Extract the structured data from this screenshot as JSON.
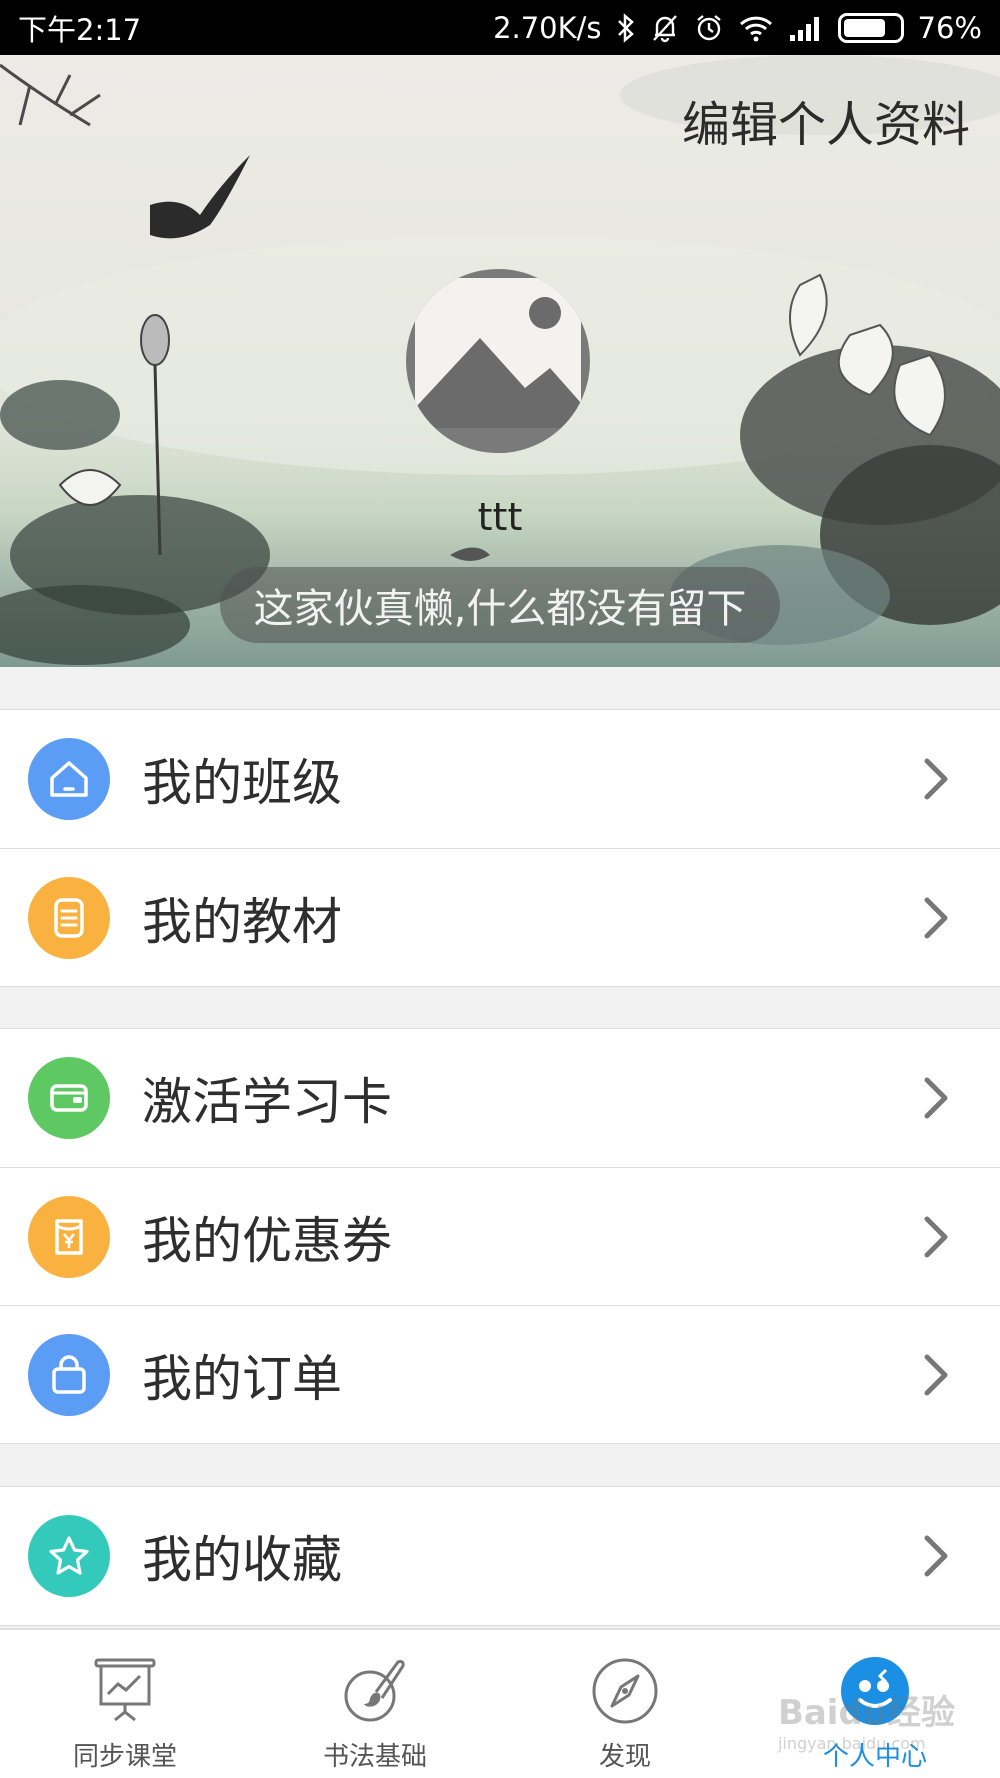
{
  "status_bar": {
    "time": "下午2:17",
    "network_speed": "2.70K/s",
    "battery_percent": "76%",
    "battery_level": 0.76,
    "icons": [
      "bluetooth-icon",
      "mute-icon",
      "alarm-icon",
      "wifi-icon",
      "signal-icon",
      "battery-icon"
    ]
  },
  "header": {
    "edit_profile": "编辑个人资料",
    "username": "ttt",
    "signature": "这家伙真懒,什么都没有留下"
  },
  "menu_groups": [
    {
      "items": [
        {
          "label": "我的班级",
          "icon": "house-icon",
          "color": "#5b9cf5"
        },
        {
          "label": "我的教材",
          "icon": "book-icon",
          "color": "#f9b240"
        }
      ]
    },
    {
      "items": [
        {
          "label": "激活学习卡",
          "icon": "card-icon",
          "color": "#5ec962"
        },
        {
          "label": "我的优惠券",
          "icon": "coupon-icon",
          "color": "#f9b240"
        },
        {
          "label": "我的订单",
          "icon": "bag-icon",
          "color": "#5b9cf5"
        }
      ]
    },
    {
      "items": [
        {
          "label": "我的收藏",
          "icon": "star-icon",
          "color": "#33c9bb"
        }
      ]
    }
  ],
  "tab_bar": {
    "tabs": [
      {
        "label": "同步课堂",
        "icon": "whiteboard-icon"
      },
      {
        "label": "书法基础",
        "icon": "brush-icon"
      },
      {
        "label": "发现",
        "icon": "compass-icon"
      },
      {
        "label": "个人中心",
        "icon": "profile-icon",
        "active": true
      }
    ],
    "accent": "#1a8fe3"
  },
  "watermark": {
    "brand": "Baidu经验",
    "url": "jingyan.baidu.com"
  }
}
